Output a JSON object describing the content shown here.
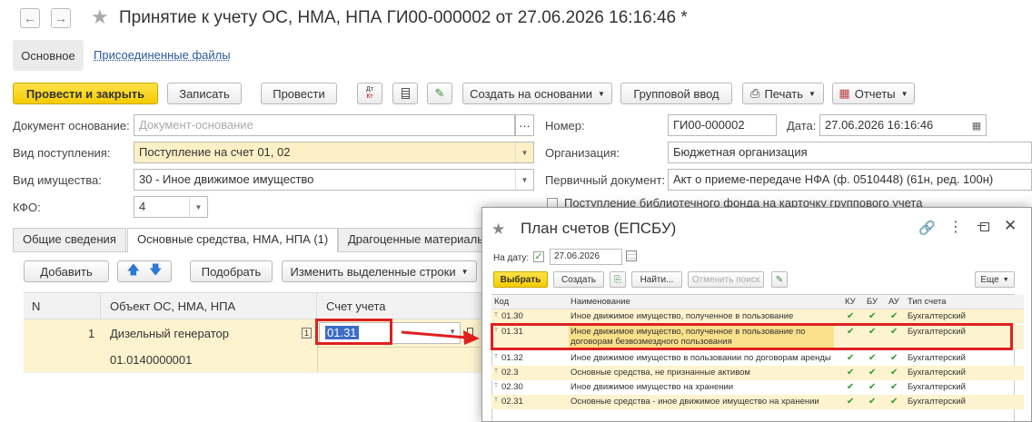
{
  "window": {
    "title": "Принятие к учету ОС, НМА, НПА ГИ00-000002 от 27.06.2026 16:16:46 *"
  },
  "nav_tabs": {
    "main": "Основное",
    "files": "Присоединенные файлы"
  },
  "toolbar": {
    "post_close": "Провести и закрыть",
    "save": "Записать",
    "post": "Провести",
    "dtkt_top": "Дт",
    "dtkt_bottom": "Кт",
    "create_based": "Создать на основании",
    "group_input": "Групповой ввод",
    "print": "Печать",
    "reports": "Отчеты"
  },
  "form": {
    "doc_base_label": "Документ основание:",
    "doc_base_placeholder": "Документ-основание",
    "receipt_type_label": "Вид поступления:",
    "receipt_type_value": "Поступление на счет 01, 02",
    "property_type_label": "Вид имущества:",
    "property_type_value": "30 - Иное движимое имущество",
    "kfo_label": "КФО:",
    "kfo_value": "4",
    "number_label": "Номер:",
    "number_value": "ГИ00-000002",
    "date_label": "Дата:",
    "date_value": "27.06.2026 16:16:46",
    "org_label": "Организация:",
    "org_value": "Бюджетная организация",
    "primary_doc_label": "Первичный документ:",
    "primary_doc_value": "Акт о приеме-передаче НФА (ф. 0510448) (61н, ред. 100н)",
    "library_checkbox": "Поступление библиотечного фонда на карточку группового учета"
  },
  "tabs": [
    "Общие сведения",
    "Основные средства, НМА, НПА (1)",
    "Драгоценные материалы"
  ],
  "table_toolbar": {
    "add": "Добавить",
    "pick": "Подобрать",
    "change_rows": "Изменить выделенные строки"
  },
  "table": {
    "headers": {
      "n": "N",
      "object": "Объект ОС, НМА, НПА",
      "account": "Счет учета"
    },
    "row": {
      "n": "1",
      "name": "Дизельный генератор",
      "inv": "01.0140000001",
      "badge": "1",
      "account": "01.31"
    }
  },
  "popup": {
    "title": "План счетов (ЕПСБУ)",
    "date_label": "На дату:",
    "date_value": "27.06.2026",
    "buttons": {
      "select": "Выбрать",
      "create": "Создать",
      "find": "Найти...",
      "cancel_search": "Отменить поиск",
      "more": "Еще"
    },
    "headers": {
      "code": "Код",
      "name": "Наименование",
      "ku": "КУ",
      "bu": "БУ",
      "au": "АУ",
      "type": "Тип счета"
    },
    "rows": [
      {
        "code": "01.30",
        "name": "Иное движимое имущество, полученное в пользование",
        "type": "Бухгалтерский"
      },
      {
        "code": "01.31",
        "name": "Иное движимое имущество, полученное в пользование по",
        "name2": "договорам безвозмездного пользования",
        "type": "Бухгалтерский"
      },
      {
        "code": "01.32",
        "name": "Иное движимое имущество в пользовании по договорам аренды",
        "type": "Бухгалтерский"
      },
      {
        "code": "02.3",
        "name": "Основные средства, не признанные активом",
        "type": "Бухгалтерский"
      },
      {
        "code": "02.30",
        "name": "Иное движимое имущество на хранении",
        "type": "Бухгалтерский"
      },
      {
        "code": "02.31",
        "name": "Основные средства - иное движимое имущество на хранении",
        "type": "Бухгалтерский"
      }
    ]
  },
  "colors": {
    "accent_yellow": "#f5cc00",
    "highlight_red": "#e02020",
    "row_yellow": "#fdf3cf"
  }
}
